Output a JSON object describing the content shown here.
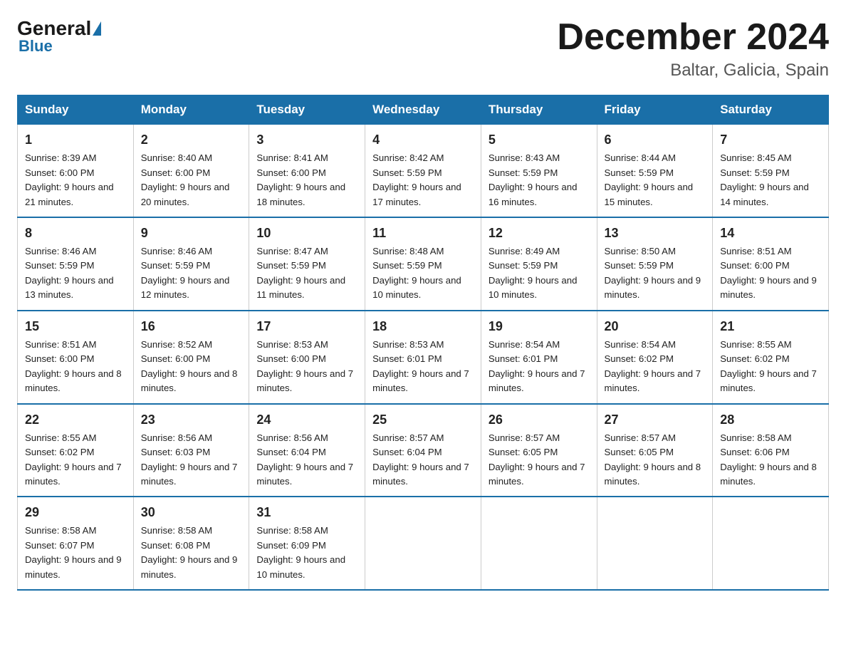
{
  "header": {
    "logo_general": "General",
    "logo_blue": "Blue",
    "month_title": "December 2024",
    "location": "Baltar, Galicia, Spain"
  },
  "days_of_week": [
    "Sunday",
    "Monday",
    "Tuesday",
    "Wednesday",
    "Thursday",
    "Friday",
    "Saturday"
  ],
  "weeks": [
    [
      {
        "day": "1",
        "sunrise": "8:39 AM",
        "sunset": "6:00 PM",
        "daylight": "9 hours and 21 minutes."
      },
      {
        "day": "2",
        "sunrise": "8:40 AM",
        "sunset": "6:00 PM",
        "daylight": "9 hours and 20 minutes."
      },
      {
        "day": "3",
        "sunrise": "8:41 AM",
        "sunset": "6:00 PM",
        "daylight": "9 hours and 18 minutes."
      },
      {
        "day": "4",
        "sunrise": "8:42 AM",
        "sunset": "5:59 PM",
        "daylight": "9 hours and 17 minutes."
      },
      {
        "day": "5",
        "sunrise": "8:43 AM",
        "sunset": "5:59 PM",
        "daylight": "9 hours and 16 minutes."
      },
      {
        "day": "6",
        "sunrise": "8:44 AM",
        "sunset": "5:59 PM",
        "daylight": "9 hours and 15 minutes."
      },
      {
        "day": "7",
        "sunrise": "8:45 AM",
        "sunset": "5:59 PM",
        "daylight": "9 hours and 14 minutes."
      }
    ],
    [
      {
        "day": "8",
        "sunrise": "8:46 AM",
        "sunset": "5:59 PM",
        "daylight": "9 hours and 13 minutes."
      },
      {
        "day": "9",
        "sunrise": "8:46 AM",
        "sunset": "5:59 PM",
        "daylight": "9 hours and 12 minutes."
      },
      {
        "day": "10",
        "sunrise": "8:47 AM",
        "sunset": "5:59 PM",
        "daylight": "9 hours and 11 minutes."
      },
      {
        "day": "11",
        "sunrise": "8:48 AM",
        "sunset": "5:59 PM",
        "daylight": "9 hours and 10 minutes."
      },
      {
        "day": "12",
        "sunrise": "8:49 AM",
        "sunset": "5:59 PM",
        "daylight": "9 hours and 10 minutes."
      },
      {
        "day": "13",
        "sunrise": "8:50 AM",
        "sunset": "5:59 PM",
        "daylight": "9 hours and 9 minutes."
      },
      {
        "day": "14",
        "sunrise": "8:51 AM",
        "sunset": "6:00 PM",
        "daylight": "9 hours and 9 minutes."
      }
    ],
    [
      {
        "day": "15",
        "sunrise": "8:51 AM",
        "sunset": "6:00 PM",
        "daylight": "9 hours and 8 minutes."
      },
      {
        "day": "16",
        "sunrise": "8:52 AM",
        "sunset": "6:00 PM",
        "daylight": "9 hours and 8 minutes."
      },
      {
        "day": "17",
        "sunrise": "8:53 AM",
        "sunset": "6:00 PM",
        "daylight": "9 hours and 7 minutes."
      },
      {
        "day": "18",
        "sunrise": "8:53 AM",
        "sunset": "6:01 PM",
        "daylight": "9 hours and 7 minutes."
      },
      {
        "day": "19",
        "sunrise": "8:54 AM",
        "sunset": "6:01 PM",
        "daylight": "9 hours and 7 minutes."
      },
      {
        "day": "20",
        "sunrise": "8:54 AM",
        "sunset": "6:02 PM",
        "daylight": "9 hours and 7 minutes."
      },
      {
        "day": "21",
        "sunrise": "8:55 AM",
        "sunset": "6:02 PM",
        "daylight": "9 hours and 7 minutes."
      }
    ],
    [
      {
        "day": "22",
        "sunrise": "8:55 AM",
        "sunset": "6:02 PM",
        "daylight": "9 hours and 7 minutes."
      },
      {
        "day": "23",
        "sunrise": "8:56 AM",
        "sunset": "6:03 PM",
        "daylight": "9 hours and 7 minutes."
      },
      {
        "day": "24",
        "sunrise": "8:56 AM",
        "sunset": "6:04 PM",
        "daylight": "9 hours and 7 minutes."
      },
      {
        "day": "25",
        "sunrise": "8:57 AM",
        "sunset": "6:04 PM",
        "daylight": "9 hours and 7 minutes."
      },
      {
        "day": "26",
        "sunrise": "8:57 AM",
        "sunset": "6:05 PM",
        "daylight": "9 hours and 7 minutes."
      },
      {
        "day": "27",
        "sunrise": "8:57 AM",
        "sunset": "6:05 PM",
        "daylight": "9 hours and 8 minutes."
      },
      {
        "day": "28",
        "sunrise": "8:58 AM",
        "sunset": "6:06 PM",
        "daylight": "9 hours and 8 minutes."
      }
    ],
    [
      {
        "day": "29",
        "sunrise": "8:58 AM",
        "sunset": "6:07 PM",
        "daylight": "9 hours and 9 minutes."
      },
      {
        "day": "30",
        "sunrise": "8:58 AM",
        "sunset": "6:08 PM",
        "daylight": "9 hours and 9 minutes."
      },
      {
        "day": "31",
        "sunrise": "8:58 AM",
        "sunset": "6:09 PM",
        "daylight": "9 hours and 10 minutes."
      },
      null,
      null,
      null,
      null
    ]
  ]
}
